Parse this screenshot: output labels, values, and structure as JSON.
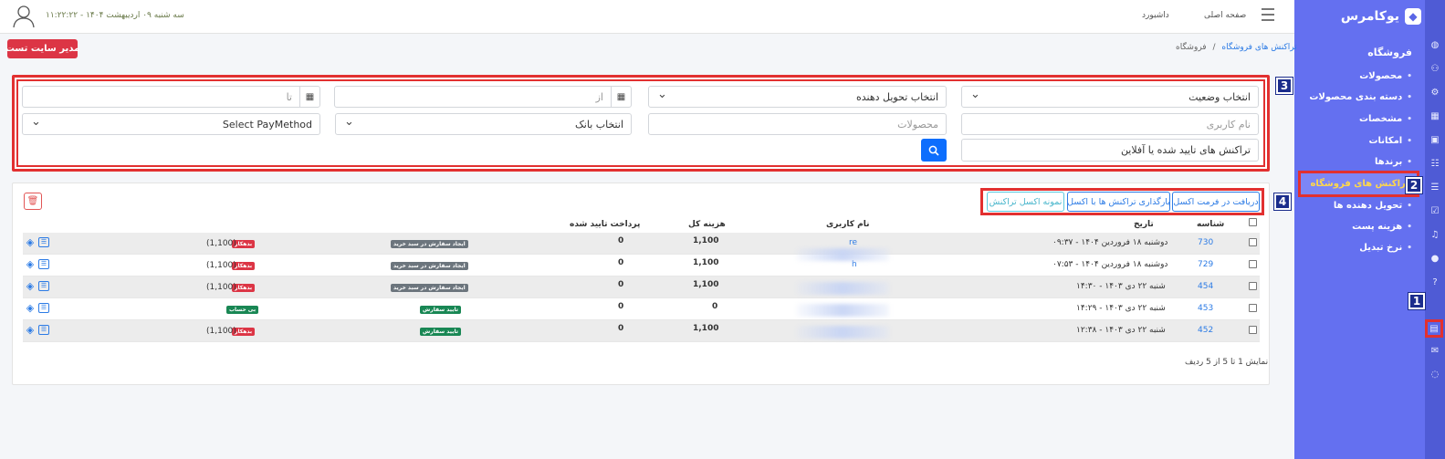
{
  "sidebar": {
    "brand": "یوکامرس",
    "section_title": "فروشگاه",
    "items": [
      {
        "label": "محصولات"
      },
      {
        "label": "دسته بندی محصولات"
      },
      {
        "label": "مشخصات"
      },
      {
        "label": "امکانات"
      },
      {
        "label": "برندها"
      },
      {
        "label": "تراکنش های فروشگاه",
        "active": true
      },
      {
        "label": "تحویل دهنده ها"
      },
      {
        "label": "هزینه پست"
      },
      {
        "label": "نرخ تبدیل"
      }
    ]
  },
  "topbar": {
    "datetime": "سه شنبه ۰۹ اردیبهشت ۱۴۰۴ - ۱۱:۲۲:۲۲",
    "home_link": "صفحه اصلی",
    "dashboard_link": "داشبورد"
  },
  "breadcrumb": {
    "root": "فروشگاه",
    "separator": "/",
    "current": "تراکنش های فروشگاه"
  },
  "admin_button": "مدیر سایت تست",
  "annotations": {
    "n1": "1",
    "n2": "2",
    "n3": "3",
    "n4": "4"
  },
  "filters": {
    "status_select": "انتخاب وضعیت",
    "delivery_select": "انتخاب تحویل دهنده",
    "from_placeholder": "از",
    "to_placeholder": "تا",
    "username_placeholder": "نام کاربری",
    "products_placeholder": "محصولات",
    "bank_select": "انتخاب بانک",
    "paymethod_select": "Select PayMethod",
    "approved_select": "تراکنش های تایید شده یا آفلاین"
  },
  "actions": {
    "export_excel": "دریافت در فرمت اکسل",
    "import_excel": "بارگذاری تراکنش ها با اکسل",
    "sample_excel": "نمونه اکسل تراکنش"
  },
  "table": {
    "headers": {
      "id": "شناسه",
      "date": "تاریخ",
      "username": "نام کاربری",
      "total": "هزینه کل",
      "paid": "پرداخت تایید شده"
    },
    "rows": [
      {
        "id": "730",
        "date": "دوشنبه ۱۸ فروردین ۱۴۰۴ - ۰۹:۳۷",
        "user": "re",
        "total": "1,100",
        "paid": "0",
        "status": "ایجاد سفارش در سبد خرید",
        "status_color": "gray",
        "debt_tag": "بدهکار",
        "debt_amount": "(1,100)"
      },
      {
        "id": "729",
        "date": "دوشنبه ۱۸ فروردین ۱۴۰۴ - ۰۷:۵۳",
        "user": "h",
        "total": "1,100",
        "paid": "0",
        "status": "ایجاد سفارش در سبد خرید",
        "status_color": "gray",
        "debt_tag": "بدهکار",
        "debt_amount": "(1,100)"
      },
      {
        "id": "454",
        "date": "شنبه ۲۲ دی ۱۴۰۳ - ۱۴:۳۰",
        "user": "",
        "total": "1,100",
        "paid": "0",
        "status": "ایجاد سفارش در سبد خرید",
        "status_color": "gray",
        "debt_tag": "بدهکار",
        "debt_amount": "(1,100)"
      },
      {
        "id": "453",
        "date": "شنبه ۲۲ دی ۱۴۰۳ - ۱۴:۲۹",
        "user": "",
        "total": "0",
        "paid": "0",
        "status": "تایید سفارش",
        "status_color": "green",
        "debt_tag": "بی حساب",
        "debt_amount": ""
      },
      {
        "id": "452",
        "date": "شنبه ۲۲ دی ۱۴۰۳ - ۱۲:۳۸",
        "user": "",
        "total": "1,100",
        "paid": "0",
        "status": "تایید سفارش",
        "status_color": "green",
        "debt_tag": "بدهکار",
        "debt_amount": "(1,100)"
      }
    ]
  },
  "pager_text": "نمایش 1 تا 5 از 5 ردیف",
  "colors": {
    "sidebar": "#6470f0",
    "rail": "#4f5bd5",
    "highlight": "#e23030",
    "badge": "#1b2d8c",
    "primary": "#0d6efd",
    "danger": "#dc3545"
  }
}
